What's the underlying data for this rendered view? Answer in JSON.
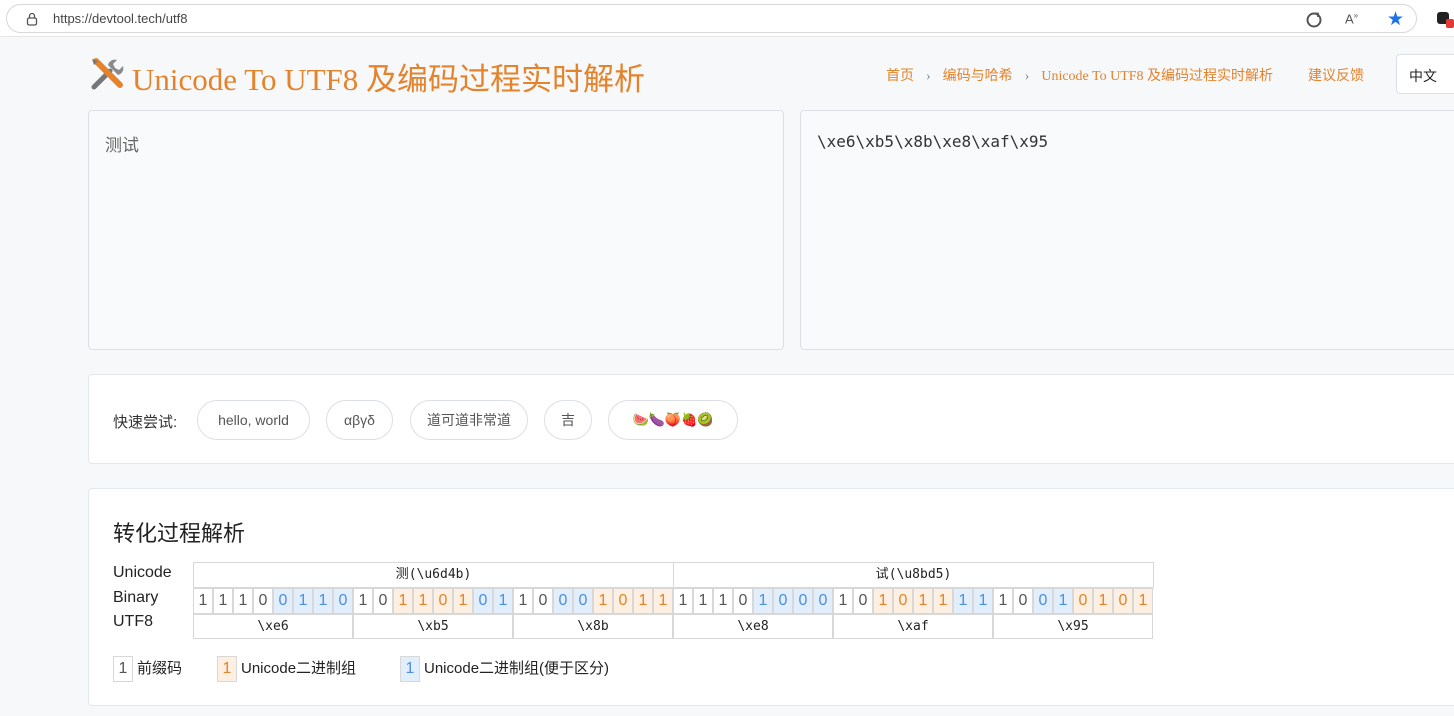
{
  "browser": {
    "url": "https://devtool.tech/utf8"
  },
  "header": {
    "title": "Unicode To UTF8 及编码过程实时解析",
    "breadcrumb": [
      "首页",
      "编码与哈希",
      "Unicode To UTF8 及编码过程实时解析"
    ],
    "feedback": "建议反馈",
    "language": "中文"
  },
  "editor": {
    "input_value": "测试",
    "output_value": "\\xe6\\xb5\\x8b\\xe8\\xaf\\x95"
  },
  "quick_try": {
    "label": "快速尝试:",
    "chips": [
      "hello, world",
      "αβγδ",
      "道可道非常道",
      "吉",
      "🍉🍆🍑🍓🥝"
    ]
  },
  "analysis": {
    "title": "转化过程解析",
    "row_labels": [
      "Unicode",
      "Binary",
      "UTF8"
    ],
    "characters": [
      {
        "char": "测",
        "code": "(\\u6d4b)"
      },
      {
        "char": "试",
        "code": "(\\u8bd5)"
      }
    ],
    "bits": [
      {
        "v": "1",
        "k": "p"
      },
      {
        "v": "1",
        "k": "p"
      },
      {
        "v": "1",
        "k": "p"
      },
      {
        "v": "0",
        "k": "p"
      },
      {
        "v": "0",
        "k": "a"
      },
      {
        "v": "1",
        "k": "a"
      },
      {
        "v": "1",
        "k": "a"
      },
      {
        "v": "0",
        "k": "a"
      },
      {
        "v": "1",
        "k": "p"
      },
      {
        "v": "0",
        "k": "p"
      },
      {
        "v": "1",
        "k": "u"
      },
      {
        "v": "1",
        "k": "u"
      },
      {
        "v": "0",
        "k": "u"
      },
      {
        "v": "1",
        "k": "u"
      },
      {
        "v": "0",
        "k": "a"
      },
      {
        "v": "1",
        "k": "a"
      },
      {
        "v": "1",
        "k": "p"
      },
      {
        "v": "0",
        "k": "p"
      },
      {
        "v": "0",
        "k": "a"
      },
      {
        "v": "0",
        "k": "a"
      },
      {
        "v": "1",
        "k": "u"
      },
      {
        "v": "0",
        "k": "u"
      },
      {
        "v": "1",
        "k": "u"
      },
      {
        "v": "1",
        "k": "u"
      },
      {
        "v": "1",
        "k": "p"
      },
      {
        "v": "1",
        "k": "p"
      },
      {
        "v": "1",
        "k": "p"
      },
      {
        "v": "0",
        "k": "p"
      },
      {
        "v": "1",
        "k": "a"
      },
      {
        "v": "0",
        "k": "a"
      },
      {
        "v": "0",
        "k": "a"
      },
      {
        "v": "0",
        "k": "a"
      },
      {
        "v": "1",
        "k": "p"
      },
      {
        "v": "0",
        "k": "p"
      },
      {
        "v": "1",
        "k": "u"
      },
      {
        "v": "0",
        "k": "u"
      },
      {
        "v": "1",
        "k": "u"
      },
      {
        "v": "1",
        "k": "u"
      },
      {
        "v": "1",
        "k": "a"
      },
      {
        "v": "1",
        "k": "a"
      },
      {
        "v": "1",
        "k": "p"
      },
      {
        "v": "0",
        "k": "p"
      },
      {
        "v": "0",
        "k": "a"
      },
      {
        "v": "1",
        "k": "a"
      },
      {
        "v": "0",
        "k": "u"
      },
      {
        "v": "1",
        "k": "u"
      },
      {
        "v": "0",
        "k": "u"
      },
      {
        "v": "1",
        "k": "u"
      }
    ],
    "bytes": [
      "\\xe6",
      "\\xb5",
      "\\x8b",
      "\\xe8",
      "\\xaf",
      "\\x95"
    ],
    "legend": [
      {
        "swatch": "1",
        "label": "前缀码",
        "kind": "p"
      },
      {
        "swatch": "1",
        "label": "Unicode二进制组",
        "kind": "u"
      },
      {
        "swatch": "1",
        "label": "Unicode二进制组(便于区分)",
        "kind": "a"
      }
    ]
  }
}
